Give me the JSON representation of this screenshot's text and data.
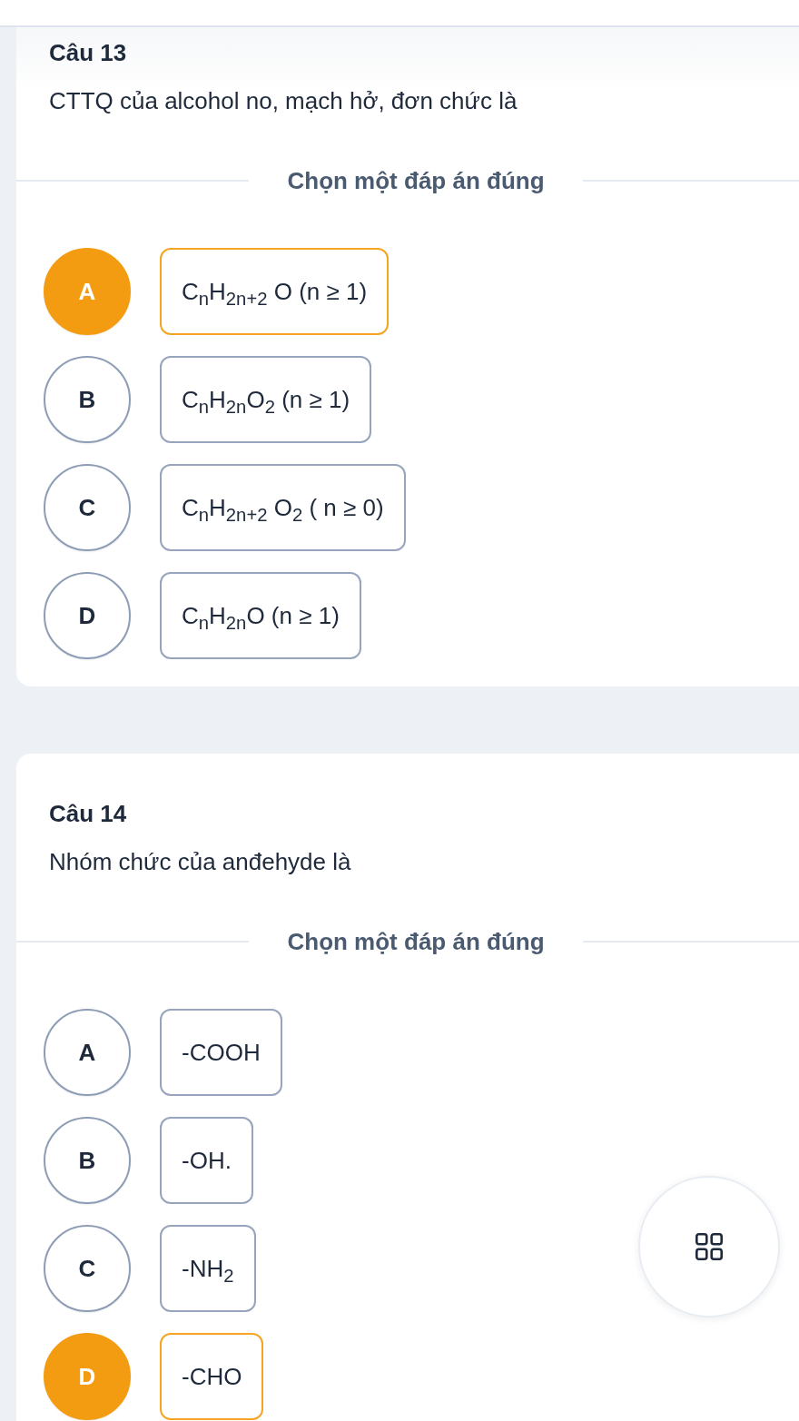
{
  "questions": [
    {
      "title": "Câu 13",
      "text": "CTTQ của alcohol no, mạch hở, đơn chức là",
      "instruction": "Chọn một đáp án đúng",
      "options": [
        {
          "letter": "A",
          "text": "C$_{n}$H$_{2n+2}$ O (n ≥ 1)",
          "selected": true
        },
        {
          "letter": "B",
          "text": "C$_{n}$H$_{2n}$O$_{2}$ (n ≥ 1)",
          "selected": false
        },
        {
          "letter": "C",
          "text": "C$_{n}$H$_{2n+2}$ O$_{2}$ ( n ≥ 0)",
          "selected": false
        },
        {
          "letter": "D",
          "text": "C$_{n}$H$_{2n}$O (n ≥ 1)",
          "selected": false
        }
      ]
    },
    {
      "title": "Câu 14",
      "text": "Nhóm chức của anđehyde là",
      "instruction": "Chọn một đáp án đúng",
      "options": [
        {
          "letter": "A",
          "text": "-COOH",
          "selected": false
        },
        {
          "letter": "B",
          "text": "-OH.",
          "selected": false
        },
        {
          "letter": "C",
          "text": "-NH$_{2}$",
          "selected": false
        },
        {
          "letter": "D",
          "text": "-CHO",
          "selected": true
        }
      ]
    }
  ]
}
